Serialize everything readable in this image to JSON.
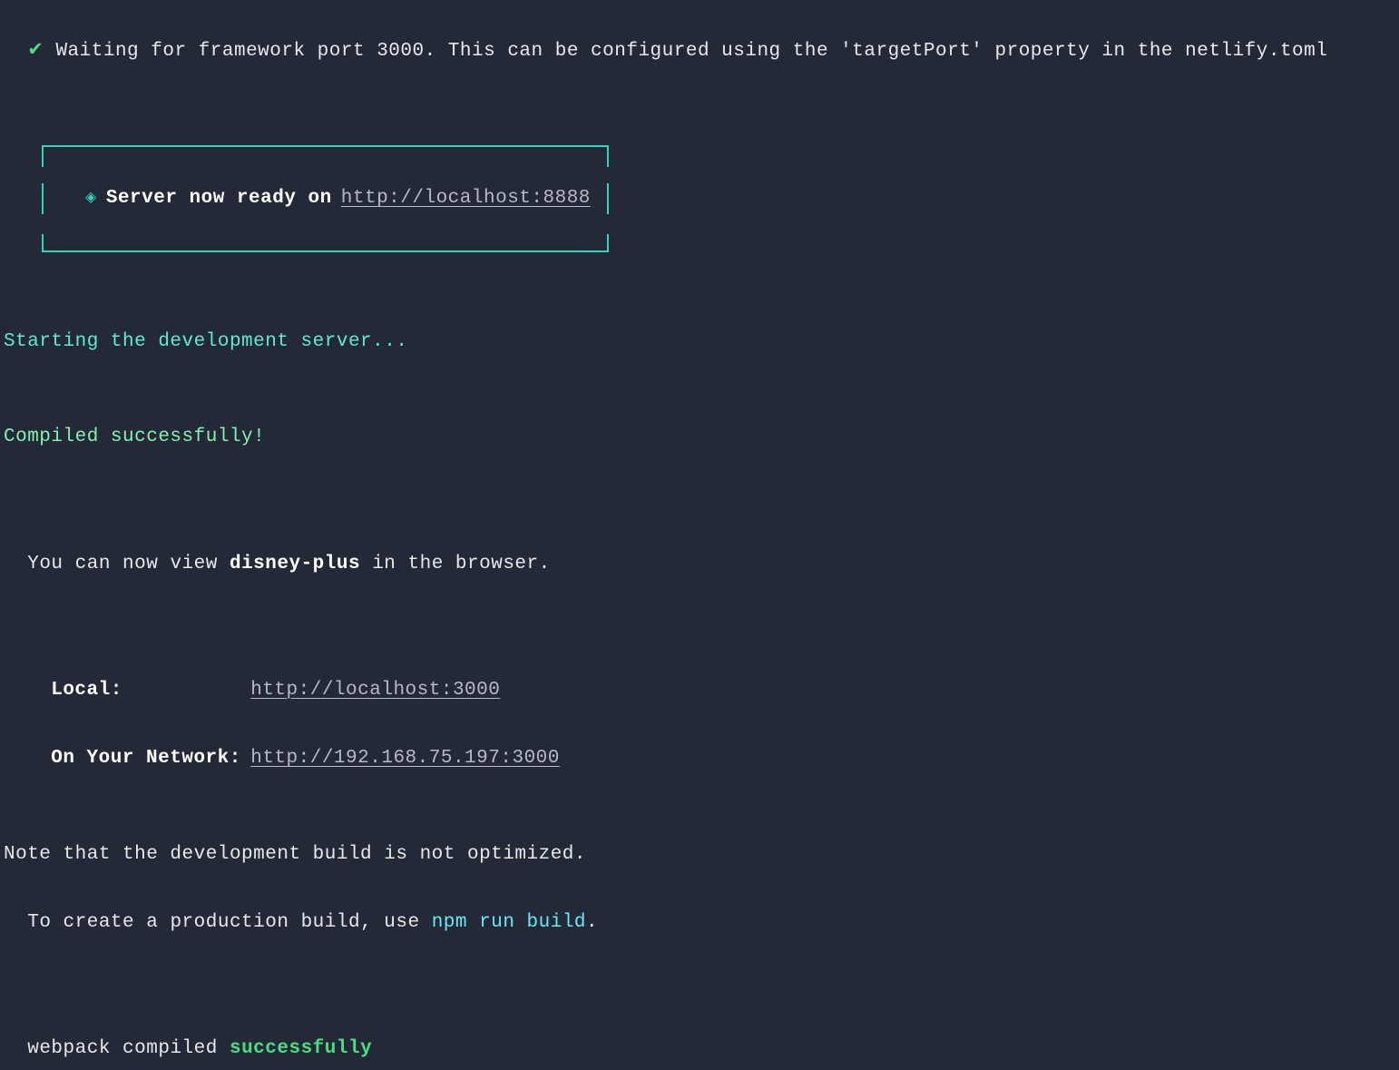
{
  "waiting": {
    "check": "✔",
    "text": "Waiting for framework port 3000. This can be configured using the 'targetPort' property in the netlify.toml"
  },
  "serverBox": {
    "diamond": "◈",
    "label": "Server now ready on",
    "url": "http://localhost:8888"
  },
  "starting": "Starting the development server...",
  "compiled": "Compiled successfully!",
  "view": {
    "prefix": "You can now view ",
    "project": "disney-plus",
    "suffix": " in the browser."
  },
  "addresses": {
    "localLabel": "Local:",
    "localUrl": "http://localhost:3000",
    "networkLabel": "On Your Network:",
    "networkUrl": "http://192.168.75.197:3000"
  },
  "note1": "Note that the development build is not optimized.",
  "note2": {
    "prefix": "To create a production build, use ",
    "cmd": "npm run build",
    "suffix": "."
  },
  "webpack": {
    "prefix": "webpack compiled ",
    "status": "successfully"
  }
}
